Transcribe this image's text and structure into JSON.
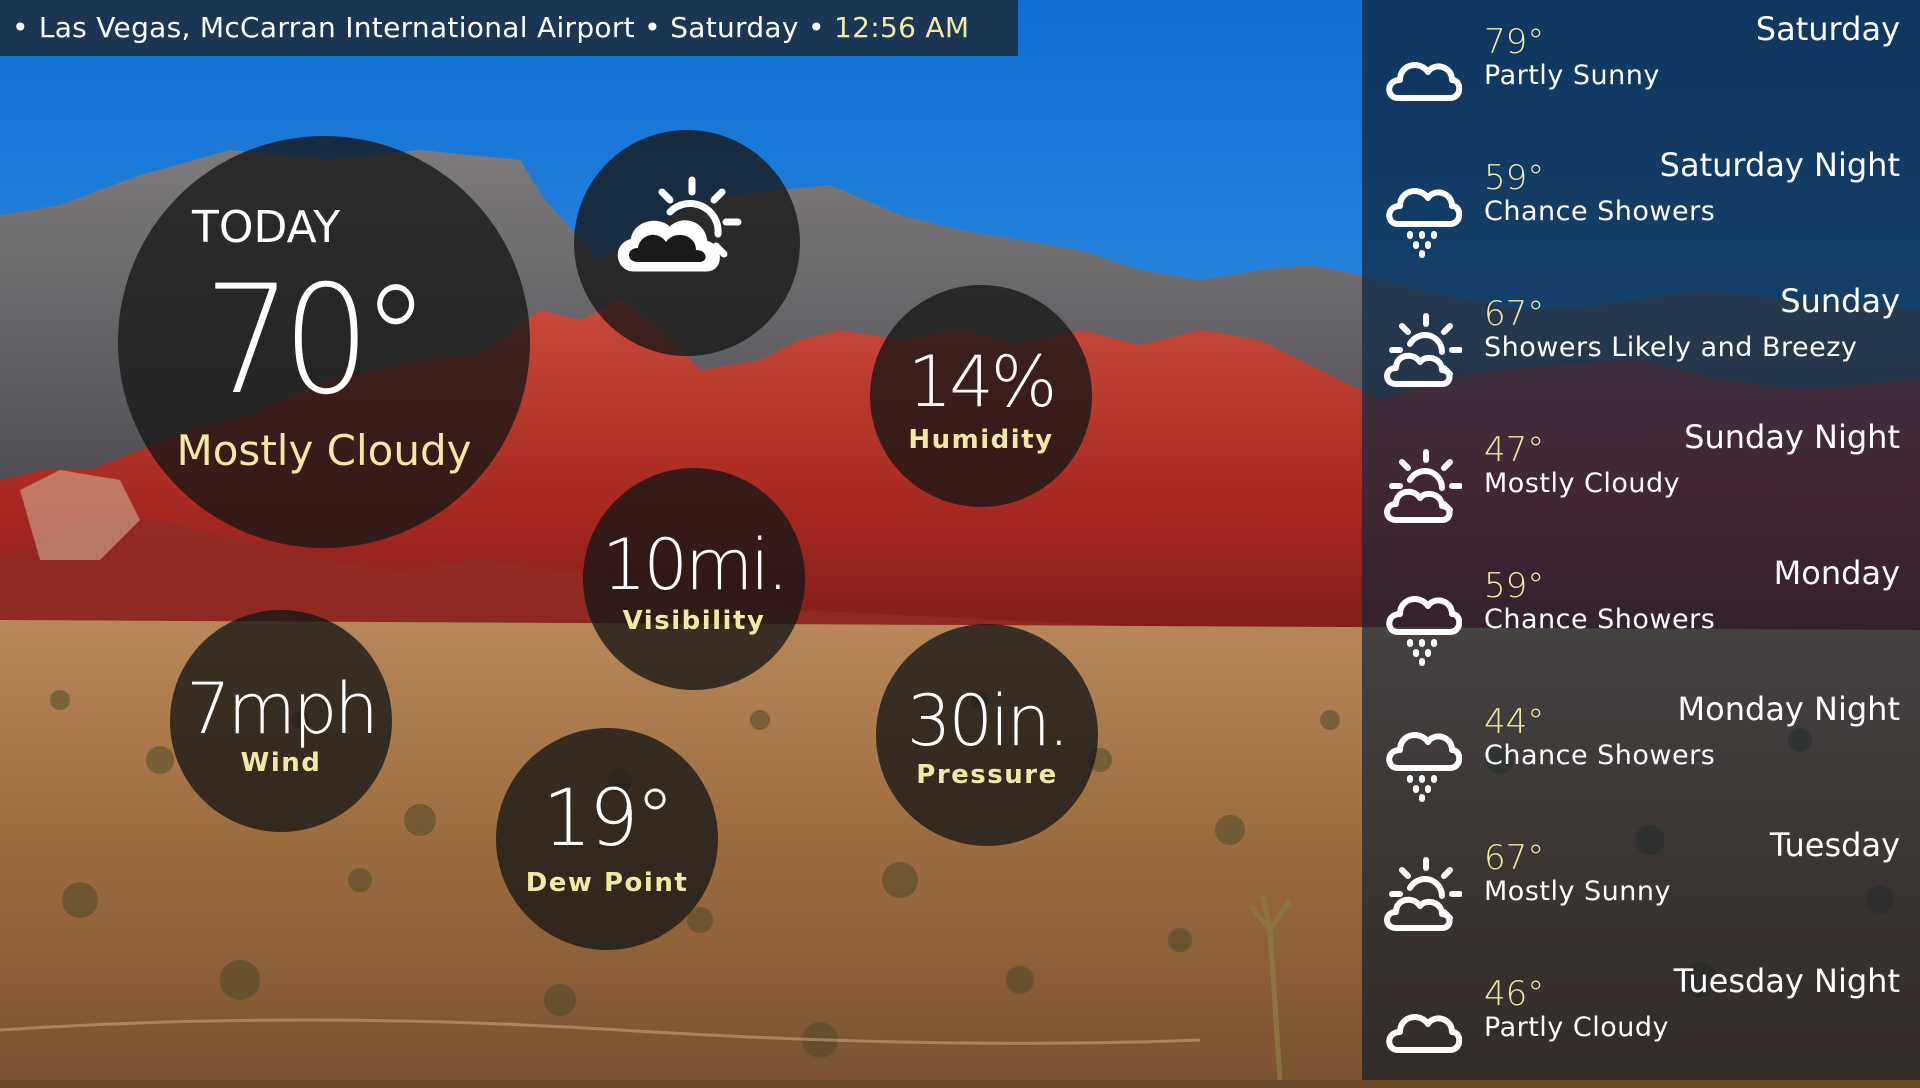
{
  "header": {
    "location": "Las Vegas, McCarran International Airport",
    "separator": "•",
    "day": "Saturday",
    "time": "12:56 AM"
  },
  "today": {
    "label": "TODAY",
    "temperature": "70°",
    "condition": "Mostly Cloudy",
    "icon": "partly-cloudy-night-icon"
  },
  "stats": {
    "humidity": {
      "value": "14%",
      "label": "Humidity"
    },
    "visibility": {
      "value": "10mi.",
      "label": "Visibility"
    },
    "wind": {
      "value": "7mph",
      "label": "Wind"
    },
    "pressure": {
      "value": "30in.",
      "label": "Pressure"
    },
    "dew_point": {
      "value": "19°",
      "label": "Dew Point"
    }
  },
  "forecast": [
    {
      "day": "Saturday",
      "temp": "79°",
      "condition": "Partly Sunny",
      "icon": "cloud-icon"
    },
    {
      "day": "Saturday Night",
      "temp": "59°",
      "condition": "Chance Showers",
      "icon": "rain-cloud-icon"
    },
    {
      "day": "Sunday",
      "temp": "67°",
      "condition": "Showers Likely and Breezy",
      "icon": "sun-cloud-icon"
    },
    {
      "day": "Sunday Night",
      "temp": "47°",
      "condition": "Mostly Cloudy",
      "icon": "sun-cloud-icon"
    },
    {
      "day": "Monday",
      "temp": "59°",
      "condition": "Chance Showers",
      "icon": "rain-cloud-icon"
    },
    {
      "day": "Monday Night",
      "temp": "44°",
      "condition": "Chance Showers",
      "icon": "rain-cloud-icon"
    },
    {
      "day": "Tuesday",
      "temp": "67°",
      "condition": "Mostly Sunny",
      "icon": "sun-cloud-icon"
    },
    {
      "day": "Tuesday Night",
      "temp": "46°",
      "condition": "Partly Cloudy",
      "icon": "cloud-icon"
    }
  ],
  "colors": {
    "accent": "#f3e9a6",
    "bubble": "#161616",
    "sidebar": "#0a2341",
    "sky": "#1e7fd0",
    "rock": "#b3322a",
    "desert": "#a47442"
  }
}
